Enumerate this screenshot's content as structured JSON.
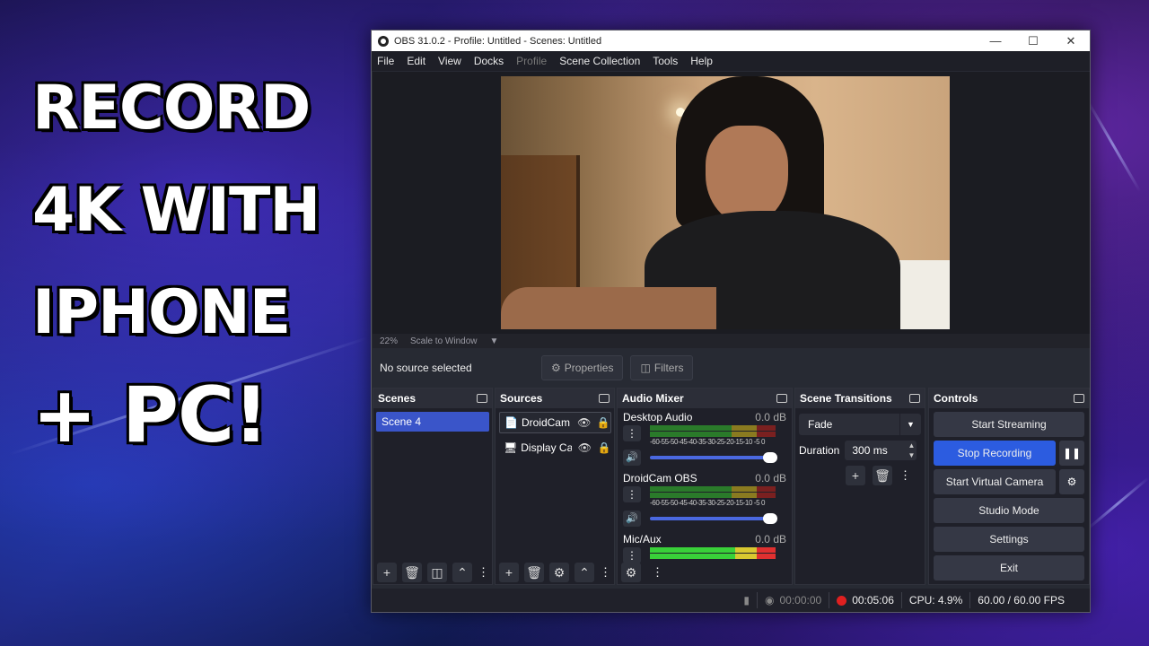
{
  "thumbnail": {
    "line1": "RECORD",
    "line2": "4K WITH",
    "line3": "IPHONE",
    "line4": "+ PC!"
  },
  "window": {
    "title": "OBS 31.0.2 - Profile: Untitled - Scenes: Untitled",
    "minimize_icon": "minimize-icon",
    "maximize_icon": "maximize-icon",
    "close_icon": "close-icon"
  },
  "menu": {
    "items": [
      "File",
      "Edit",
      "View",
      "Docks",
      "Profile",
      "Scene Collection",
      "Tools",
      "Help"
    ]
  },
  "preview": {
    "zoom": "22%",
    "scale_mode": "Scale to Window"
  },
  "source_bar": {
    "status": "No source selected",
    "properties_label": "Properties",
    "filters_label": "Filters"
  },
  "scenes": {
    "title": "Scenes",
    "items": [
      "Scene 4"
    ]
  },
  "sources": {
    "title": "Sources",
    "items": [
      "DroidCam",
      "Display Ca"
    ]
  },
  "mixer": {
    "title": "Audio Mixer",
    "scale": "-60-55-50-45-40-35-30-25-20-15-10 -5  0",
    "channels": [
      {
        "name": "Desktop Audio",
        "db": "0.0 dB",
        "volume": 1.0
      },
      {
        "name": "DroidCam OBS",
        "db": "0.0 dB",
        "volume": 1.0
      },
      {
        "name": "Mic/Aux",
        "db": "0.0 dB",
        "volume": 1.0
      }
    ]
  },
  "transitions": {
    "title": "Scene Transitions",
    "selected": "Fade",
    "duration_label": "Duration",
    "duration_value": "300 ms"
  },
  "controls": {
    "title": "Controls",
    "start_streaming": "Start Streaming",
    "stop_recording": "Stop Recording",
    "start_virtual_camera": "Start Virtual Camera",
    "studio_mode": "Studio Mode",
    "settings": "Settings",
    "exit": "Exit"
  },
  "status": {
    "stream_time": "00:00:00",
    "rec_time": "00:05:06",
    "cpu": "CPU: 4.9%",
    "fps": "60.00 / 60.00 FPS"
  },
  "colors": {
    "accent": "#3a55c9",
    "record": "#e02020"
  }
}
